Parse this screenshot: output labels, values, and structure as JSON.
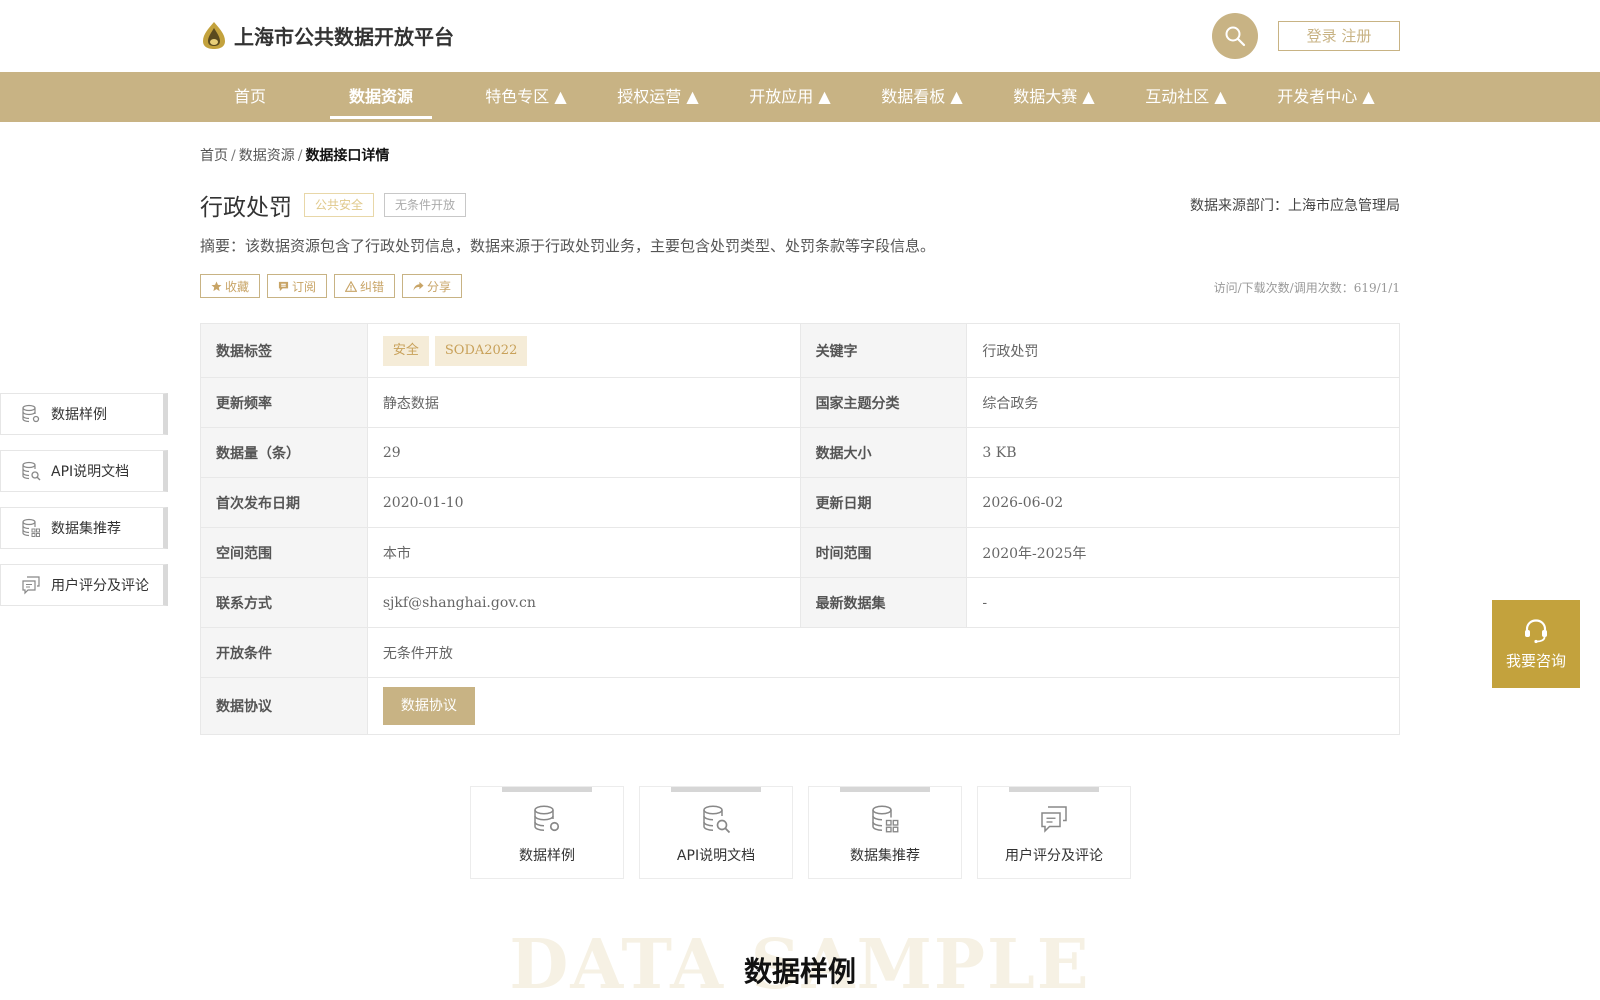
{
  "header": {
    "site_title": "上海市公共数据开放平台",
    "login_label": "登录 注册"
  },
  "nav": [
    {
      "label": "首页"
    },
    {
      "label": "数据资源"
    },
    {
      "label": "特色专区 ▲"
    },
    {
      "label": "授权运营 ▲"
    },
    {
      "label": "开放应用 ▲"
    },
    {
      "label": "数据看板 ▲"
    },
    {
      "label": "数据大赛 ▲"
    },
    {
      "label": "互动社区 ▲"
    },
    {
      "label": "开发者中心 ▲"
    }
  ],
  "breadcrumb": {
    "home": "首页",
    "resources": "数据资源",
    "current": "数据接口详情",
    "sep": "/"
  },
  "detail": {
    "title": "行政处罚",
    "tag_category": "公共安全",
    "tag_open": "无条件开放",
    "source_dept": "数据来源部门：上海市应急管理局",
    "summary": "摘要：该数据资源包含了行政处罚信息，数据来源于行政处罚业务，主要包含处罚类型、处罚条款等字段信息。",
    "actions": {
      "favorite": "收藏",
      "subscribe": "订阅",
      "report": "纠错",
      "share": "分享"
    },
    "visit_count": "访问/下载次数/调用次数：619/1/1"
  },
  "table": {
    "tags_label": "数据标签",
    "tags": [
      "安全",
      "SODA2022"
    ],
    "keyword_label": "关键字",
    "keyword": "行政处罚",
    "freq_label": "更新频率",
    "freq": "静态数据",
    "theme_label": "国家主题分类",
    "theme": "综合政务",
    "count_label": "数据量（条）",
    "count": "29",
    "size_label": "数据大小",
    "size": "3 KB",
    "first_pub_label": "首次发布日期",
    "first_pub": "2020-01-10",
    "update_label": "更新日期",
    "update": "2026-06-02",
    "space_label": "空间范围",
    "space": "本市",
    "time_label": "时间范围",
    "time": "2020年-2025年",
    "contact_label": "联系方式",
    "contact": "sjkf@shanghai.gov.cn",
    "latest_label": "最新数据集",
    "latest": "-",
    "condition_label": "开放条件",
    "condition": "无条件开放",
    "agreement_label": "数据协议",
    "agreement_btn": "数据协议"
  },
  "side_nav": [
    {
      "label": "数据样例"
    },
    {
      "label": "API说明文档"
    },
    {
      "label": "数据集推荐"
    },
    {
      "label": "用户评分及评论"
    }
  ],
  "consult_label": "我要咨询",
  "cards": [
    {
      "label": "数据样例"
    },
    {
      "label": "API说明文档"
    },
    {
      "label": "数据集推荐"
    },
    {
      "label": "用户评分及评论"
    }
  ],
  "section": {
    "bg_text": "DATA SAMPLE",
    "title": "数据样例"
  },
  "colors": {
    "brand": "#c8b384",
    "accent": "#c3a23d",
    "chip_bg": "#f5ecd8"
  }
}
